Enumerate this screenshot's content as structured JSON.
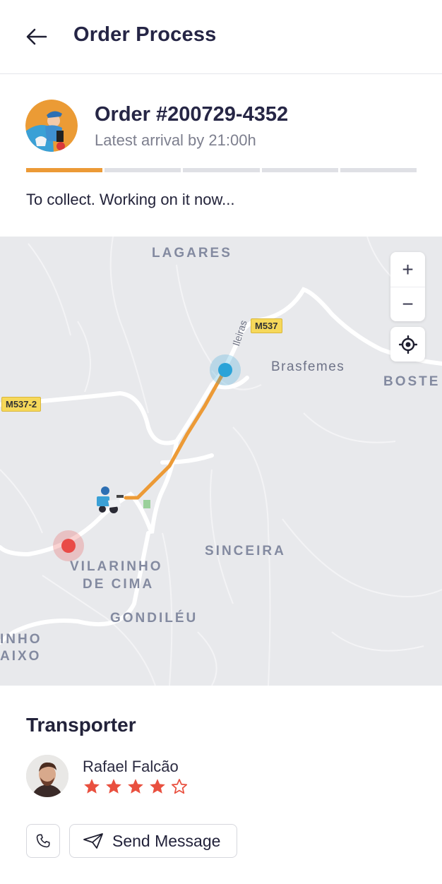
{
  "header": {
    "title": "Order Process",
    "back_icon": "arrow-left-icon"
  },
  "order": {
    "number_label": "Order #200729-4352",
    "arrival_label": "Latest arrival by 21:00h",
    "progress": {
      "completed_steps": 1,
      "total_steps": 5
    },
    "status_text": "To collect. Working on it now..."
  },
  "map": {
    "place_labels": [
      "LAGARES",
      "Brasfemes",
      "BOSTE",
      "SINCEIRA",
      "VILARINHO",
      "DE CIMA",
      "GONDILÉU",
      "INHO",
      "AIXO"
    ],
    "road_labels": [
      "M537",
      "M537-2",
      "Ileiras"
    ],
    "controls": {
      "zoom_in": "+",
      "zoom_out": "−"
    },
    "colors": {
      "route": "#ec9a36",
      "origin": "#e94b47",
      "destination": "#2aa3d8",
      "background": "#e8e9ec"
    }
  },
  "transporter": {
    "section_title": "Transporter",
    "name": "Rafael Falcão",
    "rating": 4,
    "rating_max": 5,
    "actions": {
      "message_label": "Send Message"
    }
  },
  "colors": {
    "accent": "#ec9a36",
    "star": "#e9503f",
    "text": "#22223a"
  }
}
